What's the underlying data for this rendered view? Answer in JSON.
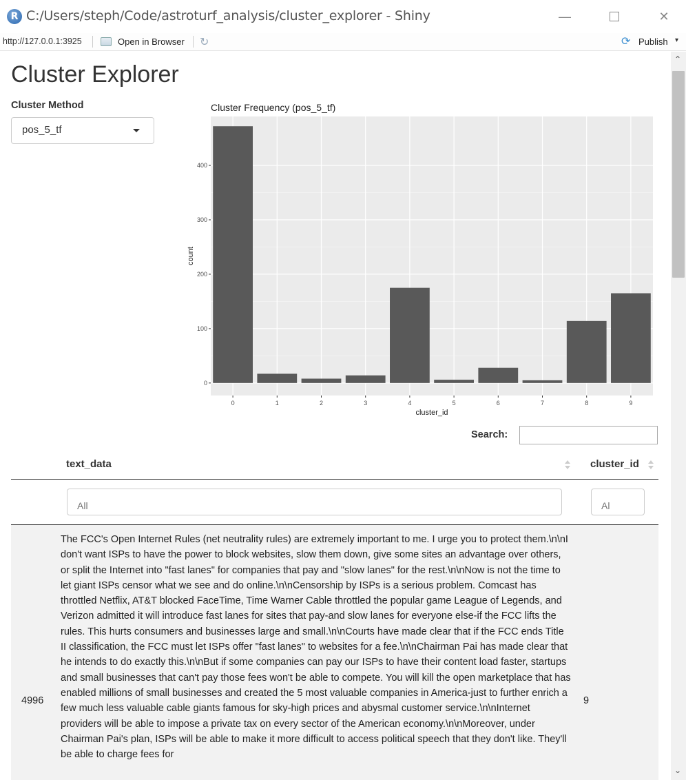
{
  "window": {
    "title": "C:/Users/steph/Code/astroturf_analysis/cluster_explorer - Shiny",
    "logo_letter": "R",
    "minimize_glyph": "—",
    "close_glyph": "✕"
  },
  "toolbar": {
    "url": "http://127.0.0.1:3925",
    "open_browser_label": "Open in Browser",
    "refresh_glyph": "↻",
    "publish_glyph": "⟳",
    "publish_label": "Publish",
    "publish_caret": "▾"
  },
  "page": {
    "title": "Cluster Explorer",
    "method_label": "Cluster Method",
    "method_value": "pos_5_tf"
  },
  "chart_data": {
    "type": "bar",
    "title": "Cluster Frequency (pos_5_tf)",
    "xlabel": "cluster_id",
    "ylabel": "count",
    "categories": [
      "0",
      "1",
      "2",
      "3",
      "4",
      "5",
      "6",
      "7",
      "8",
      "9"
    ],
    "values": [
      472,
      17,
      8,
      14,
      175,
      6,
      28,
      5,
      114,
      165
    ],
    "yticks": [
      0,
      100,
      200,
      300,
      400
    ],
    "ylim": [
      -23,
      490
    ],
    "grid": true,
    "bar_color": "#595959",
    "panel_color": "#ebebeb"
  },
  "search": {
    "label": "Search:",
    "value": ""
  },
  "table": {
    "columns": [
      "text_data",
      "cluster_id"
    ],
    "filters": [
      "All",
      "Al"
    ],
    "rows": [
      {
        "id": "4996",
        "text_data": "The FCC's Open Internet Rules (net neutrality rules) are extremely important to me. I urge you to protect them.\\n\\nI don't want ISPs to have the power to block websites, slow them down, give some sites an advantage over others, or split the Internet into \"fast lanes\" for companies that pay and \"slow lanes\" for the rest.\\n\\nNow is not the time to let giant ISPs censor what we see and do online.\\n\\nCensorship by ISPs is a serious problem. Comcast has throttled Netflix, AT&T blocked FaceTime, Time Warner Cable throttled the popular game League of Legends, and Verizon admitted it will introduce fast lanes for sites that pay-and slow lanes for everyone else-if the FCC lifts the rules. This hurts consumers and businesses large and small.\\n\\nCourts have made clear that if the FCC ends Title II classification, the FCC must let ISPs offer \"fast lanes\" to websites for a fee.\\n\\nChairman Pai has made clear that he intends to do exactly this.\\n\\nBut if some companies can pay our ISPs to have their content load faster, startups and small businesses that can't pay those fees won't be able to compete. You will kill the open marketplace that has enabled millions of small businesses and created the 5 most valuable companies in America-just to further enrich a few much less valuable cable giants famous for sky-high prices and abysmal customer service.\\n\\nInternet providers will be able to impose a private tax on every sector of the American economy.\\n\\nMoreover, under Chairman Pai's plan, ISPs will be able to make it more difficult to access political speech that they don't like. They'll be able to charge fees for",
        "cluster_id": "9"
      }
    ]
  },
  "scrollbar": {
    "up_glyph": "⌃",
    "down_glyph": "⌄"
  }
}
